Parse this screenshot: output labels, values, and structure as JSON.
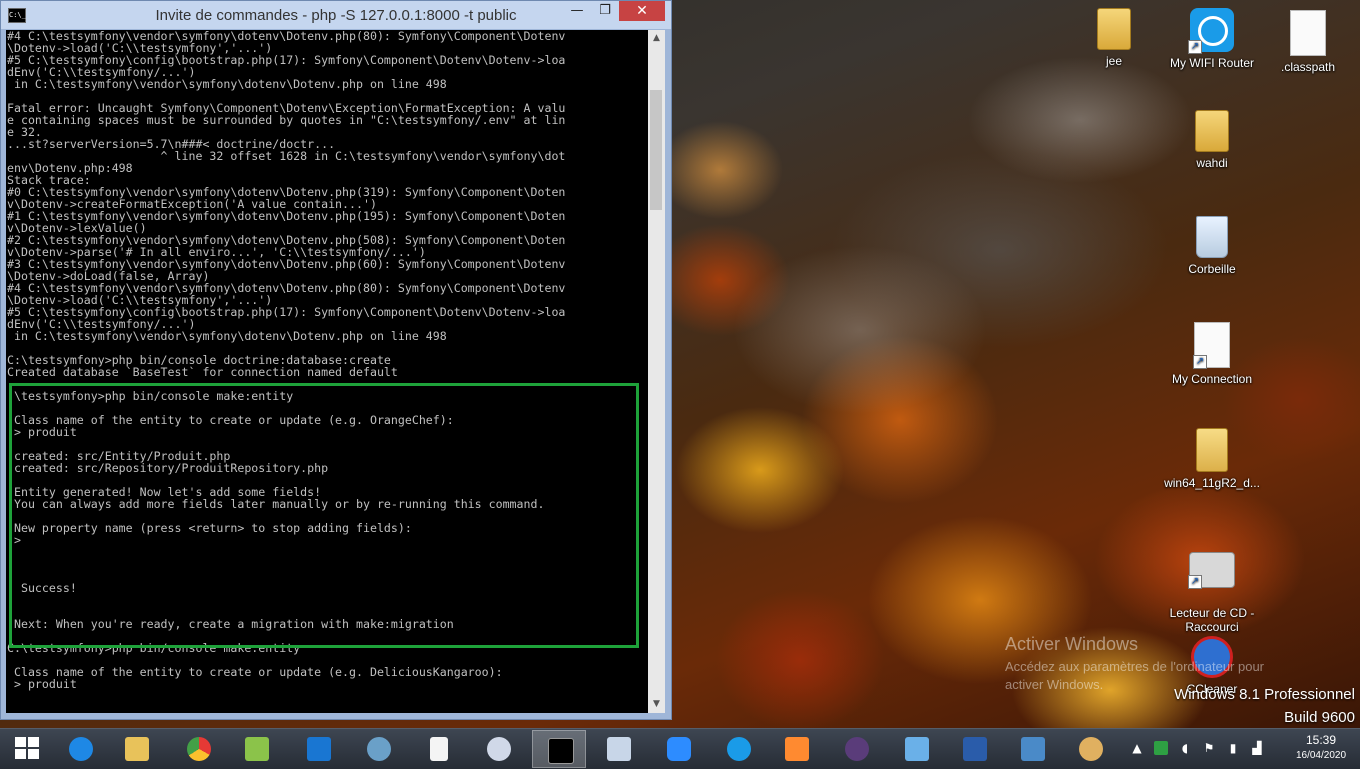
{
  "window": {
    "title": "Invite de commandes - php  -S 127.0.0.1:8000 -t public",
    "icon_label": "C:\\_",
    "min_glyph": "—",
    "max_glyph": "❐",
    "close_glyph": "✕"
  },
  "console": {
    "lines_before": "#4 C:\\testsymfony\\vendor\\symfony\\dotenv\\Dotenv.php(80): Symfony\\Component\\Dotenv\n\\Dotenv->load('C:\\\\testsymfony','...')\n#5 C:\\testsymfony\\config\\bootstrap.php(17): Symfony\\Component\\Dotenv\\Dotenv->loa\ndEnv('C:\\\\testsymfony/...')\n in C:\\testsymfony\\vendor\\symfony\\dotenv\\Dotenv.php on line 498\n\nFatal error: Uncaught Symfony\\Component\\Dotenv\\Exception\\FormatException: A valu\ne containing spaces must be surrounded by quotes in \"C:\\testsymfony/.env\" at lin\ne 32.\n...st?serverVersion=5.7\\n###< doctrine/doctr...\n                      ^ line 32 offset 1628 in C:\\testsymfony\\vendor\\symfony\\dot\nenv\\Dotenv.php:498\nStack trace:\n#0 C:\\testsymfony\\vendor\\symfony\\dotenv\\Dotenv.php(319): Symfony\\Component\\Doten\nv\\Dotenv->createFormatException('A value contain...')\n#1 C:\\testsymfony\\vendor\\symfony\\dotenv\\Dotenv.php(195): Symfony\\Component\\Doten\nv\\Dotenv->lexValue()\n#2 C:\\testsymfony\\vendor\\symfony\\dotenv\\Dotenv.php(508): Symfony\\Component\\Doten\nv\\Dotenv->parse('# In all enviro...', 'C:\\\\testsymfony/...')\n#3 C:\\testsymfony\\vendor\\symfony\\dotenv\\Dotenv.php(60): Symfony\\Component\\Dotenv\n\\Dotenv->doLoad(false, Array)\n#4 C:\\testsymfony\\vendor\\symfony\\dotenv\\Dotenv.php(80): Symfony\\Component\\Dotenv\n\\Dotenv->load('C:\\\\testsymfony','...')\n#5 C:\\testsymfony\\config\\bootstrap.php(17): Symfony\\Component\\Dotenv\\Dotenv->loa\ndEnv('C:\\\\testsymfony/...')\n in C:\\testsymfony\\vendor\\symfony\\dotenv\\Dotenv.php on line 498\n\nC:\\testsymfony>php bin/console doctrine:database:create\nCreated database `BaseTest` for connection named default",
    "lines_highlight": ":\\testsymfony>php bin/console make:entity\n\n Class name of the entity to create or update (e.g. OrangeChef):\n > produit\n\n created: src/Entity/Produit.php\n created: src/Repository/ProduitRepository.php\n\n Entity generated! Now let's add some fields!\n You can always add more fields later manually or by re-running this command.\n\n New property name (press <return> to stop adding fields):\n >\n\n\n\n  Success!\n\n\n Next: When you're ready, create a migration with make:migration",
    "lines_after": "C:\\testsymfony>php bin/console make:entity\n\n Class name of the entity to create or update (e.g. DeliciousKangaroo):\n > produit"
  },
  "desktop": {
    "icons": [
      {
        "label": "jee"
      },
      {
        "label": "My WIFI Router"
      },
      {
        "label": ".classpath"
      },
      {
        "label": "wahdi"
      },
      {
        "label": "Corbeille"
      },
      {
        "label": "My Connection"
      },
      {
        "label": "win64_11gR2_d..."
      },
      {
        "label": "Lecteur de CD -\nRaccourci"
      },
      {
        "label": "CCleaner"
      }
    ],
    "watermark_title": "Activer Windows",
    "watermark_text": "Accédez aux paramètres de l'ordinateur pour\nactiver Windows.",
    "os_name": "Windows 8.1 Professionnel",
    "os_build": "Build 9600"
  },
  "taskbar": {
    "items": [
      {
        "name": "start",
        "icon": "windows-logo-icon"
      },
      {
        "name": "internet-explorer",
        "icon": "ie-icon",
        "color": "#1e88e5"
      },
      {
        "name": "file-explorer",
        "icon": "folder-icon",
        "color": "#e8c25a"
      },
      {
        "name": "chrome",
        "icon": "chrome-icon",
        "color": "#e53935"
      },
      {
        "name": "notepad-plus",
        "icon": "notepad-icon",
        "color": "#8bc34a"
      },
      {
        "name": "vscode",
        "icon": "vscode-icon",
        "color": "#1976d2"
      },
      {
        "name": "app-globe",
        "icon": "globe-icon",
        "color": "#6aa0c8"
      },
      {
        "name": "document",
        "icon": "document-icon",
        "color": "#f4f4f4"
      },
      {
        "name": "snipping",
        "icon": "scissors-icon",
        "color": "#d0d8e8"
      },
      {
        "name": "cmd",
        "icon": "cmd-icon",
        "color": "#000000"
      },
      {
        "name": "app-window",
        "icon": "window-icon",
        "color": "#c8d6e8"
      },
      {
        "name": "zoom",
        "icon": "zoom-icon",
        "color": "#2d8cff"
      },
      {
        "name": "wifi-router",
        "icon": "wifi-icon",
        "color": "#1a9be8"
      },
      {
        "name": "media-player",
        "icon": "media-icon",
        "color": "#ff8a30"
      },
      {
        "name": "java-ee-ide",
        "icon": "java-ide-icon",
        "color": "#5a3c7a"
      },
      {
        "name": "app-blue",
        "icon": "app-icon",
        "color": "#6ab0e8"
      },
      {
        "name": "word",
        "icon": "word-icon",
        "color": "#2a5caa"
      },
      {
        "name": "photos",
        "icon": "photo-icon",
        "color": "#4a8ac8"
      },
      {
        "name": "paint",
        "icon": "palette-icon",
        "color": "#e0b060"
      }
    ],
    "tray": {
      "chevron": "▲",
      "clock_time": "15:39",
      "clock_date": "16/04/2020"
    }
  },
  "colors": {
    "highlight": "#1ea23a",
    "console_text": "#c0c0c0",
    "close_button": "#c74343"
  }
}
